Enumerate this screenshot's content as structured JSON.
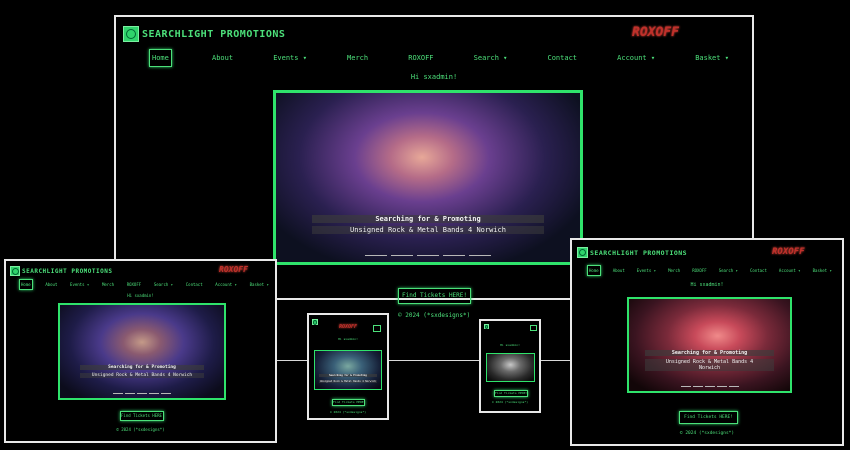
{
  "site": {
    "logo_text": "SEARCHLIGHT PROMOTIONS",
    "partner_logo": "ROXOFF",
    "greeting": "Hi sxadmin!",
    "nav": [
      "Home",
      "About",
      "Events ▾",
      "Merch",
      "ROXOFF",
      "Search ▾",
      "Contact",
      "Account ▾",
      "Basket ▾"
    ],
    "hero": {
      "caption_title": "Searching for & Promoting",
      "caption_sub": "Unsigned Rock & Metal Bands 4 Norwich",
      "sub_line1": "Unsigned Rock & Metal Bands 4",
      "sub_line2": "Norwich"
    },
    "cta_button": "Find Tickets HERE!",
    "footer": "© 2024 (*sxdesigns*)"
  },
  "colors": {
    "accent": "#2fe36b",
    "text": "#4ce07a",
    "background": "#000000",
    "partner": "#c0302b"
  },
  "icons": [
    "searchlight-logo-icon",
    "roxoff-logo-icon",
    "caret-down-icon"
  ]
}
